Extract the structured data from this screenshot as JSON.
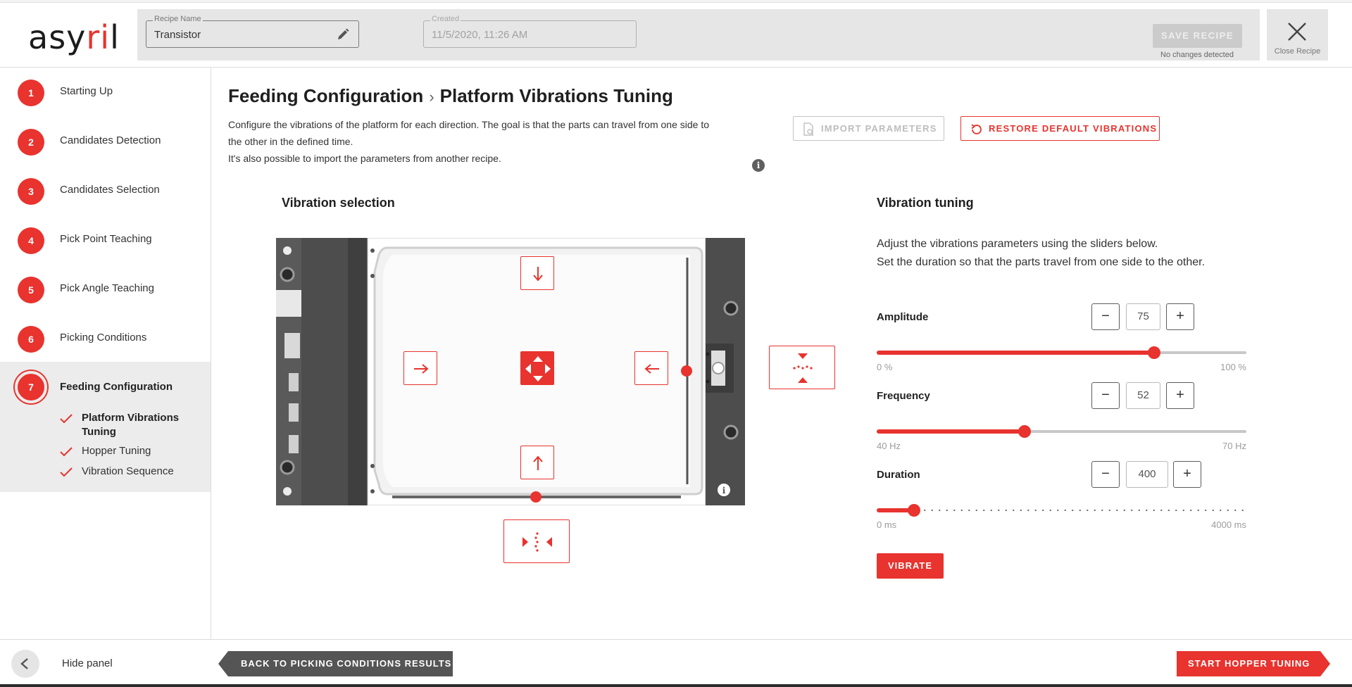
{
  "header": {
    "logo_text_1": "asy",
    "logo_text_2": "ri",
    "logo_text_3": "l",
    "recipe_name_label": "Recipe Name",
    "recipe_name_value": "Transistor",
    "created_label": "Created",
    "created_value": "11/5/2020, 11:26 AM",
    "save_label": "SAVE RECIPE",
    "save_note": "No changes detected",
    "close_label": "Close Recipe"
  },
  "sidebar": {
    "steps": [
      {
        "num": "1",
        "label": "Starting Up"
      },
      {
        "num": "2",
        "label": "Candidates Detection"
      },
      {
        "num": "3",
        "label": "Candidates Selection"
      },
      {
        "num": "4",
        "label": "Pick Point Teaching"
      },
      {
        "num": "5",
        "label": "Pick Angle Teaching"
      },
      {
        "num": "6",
        "label": "Picking Conditions"
      }
    ],
    "active_step": {
      "num": "7",
      "label": "Feeding Configuration"
    },
    "substeps": [
      {
        "label_line1": "Platform Vibrations",
        "label_line2": "Tuning"
      },
      {
        "label_line1": "Hopper Tuning"
      },
      {
        "label_line1": "Vibration Sequence"
      }
    ],
    "hide_panel_label": "Hide panel"
  },
  "main": {
    "breadcrumb_parent": "Feeding Configuration",
    "breadcrumb_sep": "›",
    "title": "Platform Vibrations Tuning",
    "description_line1": "Configure the vibrations of the platform for each direction. The goal is that the parts can travel from one side to",
    "description_line2": "the other in the defined time.",
    "description_line3": "It's also possible to import the parameters from another recipe.",
    "import_label": "IMPORT PARAMETERS",
    "restore_label": "RESTORE DEFAULT VIBRATIONS",
    "vibration_selection_title": "Vibration selection",
    "vibration_tuning_title": "Vibration tuning",
    "tuning_text_line1": "Adjust the vibrations parameters using the sliders below.",
    "tuning_text_line2": "Set the duration so that the parts travel from one side to the other.",
    "vibrate_label": "VIBRATE"
  },
  "params": {
    "amplitude": {
      "label": "Amplitude",
      "value": "75",
      "min_label": "0 %",
      "max_label": "100 %",
      "fraction": 0.75
    },
    "frequency": {
      "label": "Frequency",
      "value": "52",
      "min_label": "40 Hz",
      "max_label": "70 Hz",
      "fraction": 0.4
    },
    "duration": {
      "label": "Duration",
      "value": "400",
      "min_label": "0 ms",
      "max_label": "4000 ms",
      "fraction": 0.1
    }
  },
  "footer": {
    "back_label": "BACK TO PICKING CONDITIONS RESULTS",
    "next_label": "START HOPPER TUNING"
  },
  "colors": {
    "accent": "#e8332e",
    "sidebar_active_bg": "#ececec",
    "header_bar_bg": "#e6e6e6",
    "back_button": "#555555"
  },
  "icons": {
    "edit": "pencil-icon",
    "close": "close-icon",
    "import": "import-search-icon",
    "restore": "restore-icon",
    "info": "info-icon",
    "check": "check-icon",
    "collapse": "chevron-left-icon"
  }
}
